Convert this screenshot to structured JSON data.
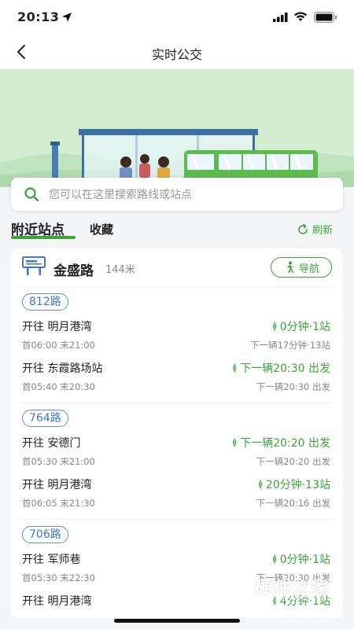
{
  "status_bar": {
    "time": "20:13"
  },
  "nav": {
    "title": "实时公交"
  },
  "search": {
    "placeholder": "您可以在这里搜索路线或站点"
  },
  "tabs": {
    "nearby": "附近站点",
    "favorites": "收藏",
    "refresh": "刷新"
  },
  "station": {
    "name": "金盛路",
    "distance": "144米",
    "navigate": "导航"
  },
  "routes": [
    {
      "number": "812路",
      "directions": [
        {
          "dir": "开往 明月港湾",
          "eta": "0分钟·1站",
          "hours": "首06:00 末21:00",
          "next": "下一辆17分钟·13站"
        },
        {
          "dir": "开往 东霞路场站",
          "eta": "下一辆20:30 出发",
          "hours": "首05:40 末20:30",
          "next": "下一辆20:30 出发"
        }
      ]
    },
    {
      "number": "764路",
      "directions": [
        {
          "dir": "开往 安德门",
          "eta": "下一辆20:20 出发",
          "hours": "首05:30 末21:00",
          "next": "下一辆20:20 出发"
        },
        {
          "dir": "开往 明月港湾",
          "eta": "20分钟·13站",
          "hours": "首06:05 末21:30",
          "next": "下一辆20:16 出发"
        }
      ]
    },
    {
      "number": "706路",
      "directions": [
        {
          "dir": "开往 军师巷",
          "eta": "0分钟·1站",
          "hours": "首05:30 末22:30",
          "next": "下一辆20:30 出发"
        },
        {
          "dir": "开往 明月港湾",
          "eta": "4分钟·1站",
          "hours": "",
          "next": ""
        }
      ]
    }
  ],
  "watermark": {
    "text": "硬件之家",
    "sub": "YINGJIANZHIJIA.COM"
  },
  "colors": {
    "accent": "#3aa53a",
    "route_badge": "#3d78cc",
    "banner": "#d2edd2"
  }
}
